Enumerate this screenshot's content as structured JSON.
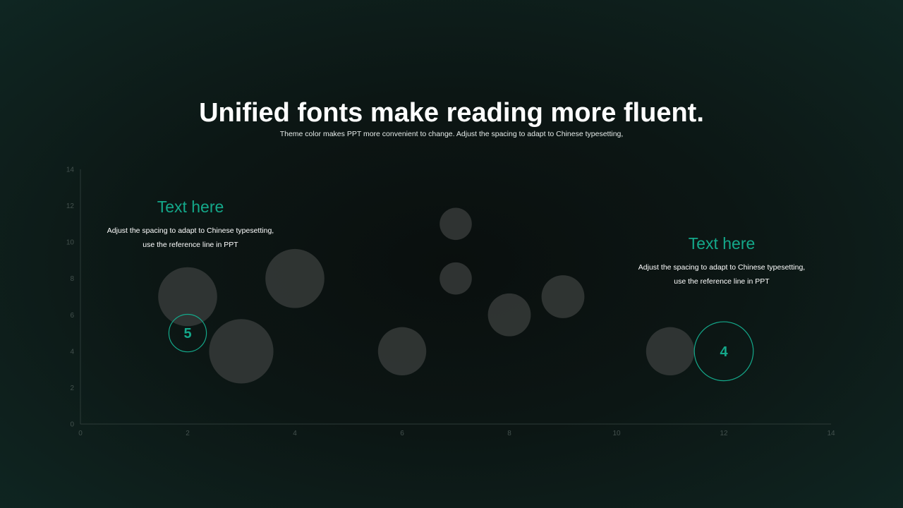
{
  "slide": {
    "title": "Unified fonts make reading more fluent.",
    "subtitle": "Theme color makes PPT more convenient to change. Adjust the spacing to adapt to Chinese typesetting,"
  },
  "callouts": [
    {
      "heading": "Text here",
      "body": "Adjust the spacing to adapt to Chinese typesetting, use the reference line in PPT"
    },
    {
      "heading": "Text here",
      "body": "Adjust the spacing to adapt to Chinese typesetting, use the reference line in PPT"
    }
  ],
  "colors": {
    "background": "#0c1614",
    "accent": "#14a88a",
    "bubble": "#3a3d3c",
    "axis": "#2c3a37",
    "tick_text": "#44514e",
    "title": "#ffffff"
  },
  "chart_data": {
    "type": "scatter",
    "title": "",
    "xlabel": "",
    "ylabel": "",
    "xlim": [
      0,
      14
    ],
    "ylim": [
      0,
      14
    ],
    "x_ticks": [
      0,
      2,
      4,
      6,
      8,
      10,
      12,
      14
    ],
    "y_ticks": [
      0,
      2,
      4,
      6,
      8,
      10,
      12,
      14
    ],
    "grid": false,
    "legend": "none",
    "bubbles": [
      {
        "x": 2,
        "y": 7,
        "size": 5.5
      },
      {
        "x": 3,
        "y": 4,
        "size": 6
      },
      {
        "x": 4,
        "y": 8,
        "size": 5.5
      },
      {
        "x": 6,
        "y": 4,
        "size": 4.5
      },
      {
        "x": 7,
        "y": 11,
        "size": 3
      },
      {
        "x": 7,
        "y": 8,
        "size": 3
      },
      {
        "x": 8,
        "y": 6,
        "size": 4
      },
      {
        "x": 9,
        "y": 7,
        "size": 4
      },
      {
        "x": 11,
        "y": 4,
        "size": 4.5
      }
    ],
    "highlighted": [
      {
        "x": 2,
        "y": 5,
        "size": 3.5,
        "label": "5"
      },
      {
        "x": 12,
        "y": 4,
        "size": 5.5,
        "label": "4"
      }
    ]
  }
}
